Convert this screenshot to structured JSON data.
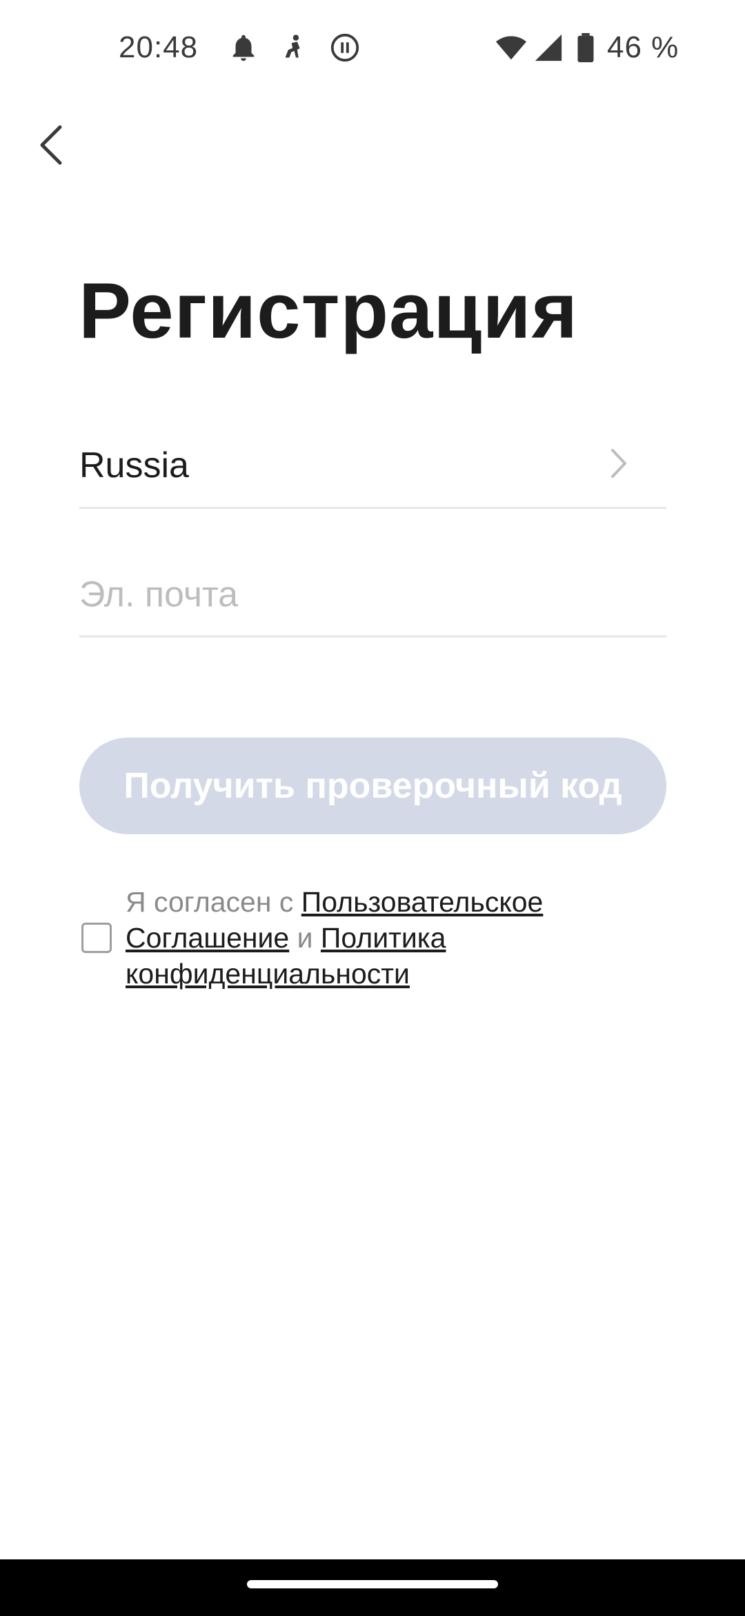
{
  "status_bar": {
    "time": "20:48",
    "battery_percent": "46 %",
    "icons": [
      "notification-bell-icon",
      "figure-icon",
      "pause-circle-icon",
      "wifi-icon",
      "signal-icon",
      "battery-icon"
    ]
  },
  "header": {
    "back_icon": "back-arrow-icon"
  },
  "title": "Регистрация",
  "country": {
    "value": "Russia",
    "icon": "chevron-right-icon"
  },
  "email": {
    "value": "",
    "placeholder": "Эл. почта"
  },
  "submit": {
    "label": "Получить проверочный код"
  },
  "agreement": {
    "checked": false,
    "prefix": "Я согласен с ",
    "terms_link": "Пользовательское Соглашение",
    "conjunction": " и ",
    "privacy_link": "Политика конфиденциальности"
  },
  "colors": {
    "button_disabled": "#d3d9e7",
    "placeholder": "#bdbdbd",
    "divider": "#e6e6e6",
    "text_primary": "#1c1c1c",
    "text_secondary": "#8a8a8a"
  }
}
